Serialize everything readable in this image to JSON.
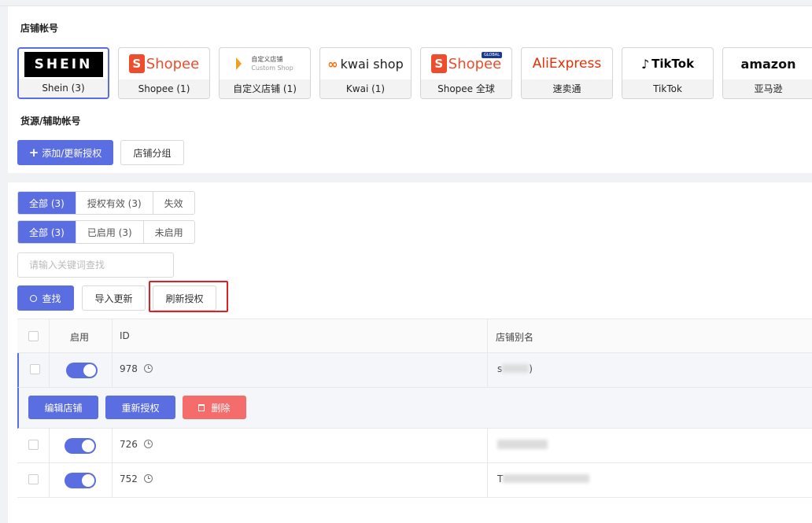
{
  "sections": {
    "store_accounts": "店铺帐号",
    "source_accounts": "货源/辅助帐号"
  },
  "shops": [
    {
      "logo": "SHEIN",
      "label": "Shein (3)"
    },
    {
      "logo": "Shopee",
      "label": "Shopee (1)"
    },
    {
      "logo": "自定义店铺",
      "logo_sub": "Custom Shop",
      "label": "自定义店铺 (1)"
    },
    {
      "logo": "kwai shop",
      "label": "Kwai (1)"
    },
    {
      "logo": "Shopee",
      "badge": "GLOBAL",
      "label": "Shopee 全球"
    },
    {
      "logo": "AliExpress",
      "label": "速卖通"
    },
    {
      "logo": "TikTok",
      "label": "TikTok"
    },
    {
      "logo": "amazon",
      "label": "亚马逊"
    }
  ],
  "toolbar": {
    "add_update_auth": "添加/更新授权",
    "shop_group": "店铺分组"
  },
  "filters": {
    "auth_status": [
      "全部 (3)",
      "授权有效 (3)",
      "失效"
    ],
    "enabled_status": [
      "全部 (3)",
      "已启用 (3)",
      "未启用"
    ]
  },
  "search": {
    "placeholder": "请输入关键词查找",
    "search_label": "查找",
    "import_update": "导入更新",
    "refresh_auth": "刷新授权"
  },
  "table": {
    "headers": {
      "enabled": "启用",
      "id": "ID",
      "alias": "店铺别名"
    },
    "rows": [
      {
        "id": "978",
        "alias_fragment_1": "s",
        "alias_fragment_2": ")"
      },
      {
        "id": "726"
      },
      {
        "id": "752",
        "alias_fragment_1": "T"
      }
    ],
    "row_actions": {
      "edit": "编辑店铺",
      "reauth": "重新授权",
      "delete": "删除"
    }
  },
  "colors": {
    "primary": "#5b6ee1",
    "danger": "#f56c6c",
    "highlight": "#e02020"
  }
}
